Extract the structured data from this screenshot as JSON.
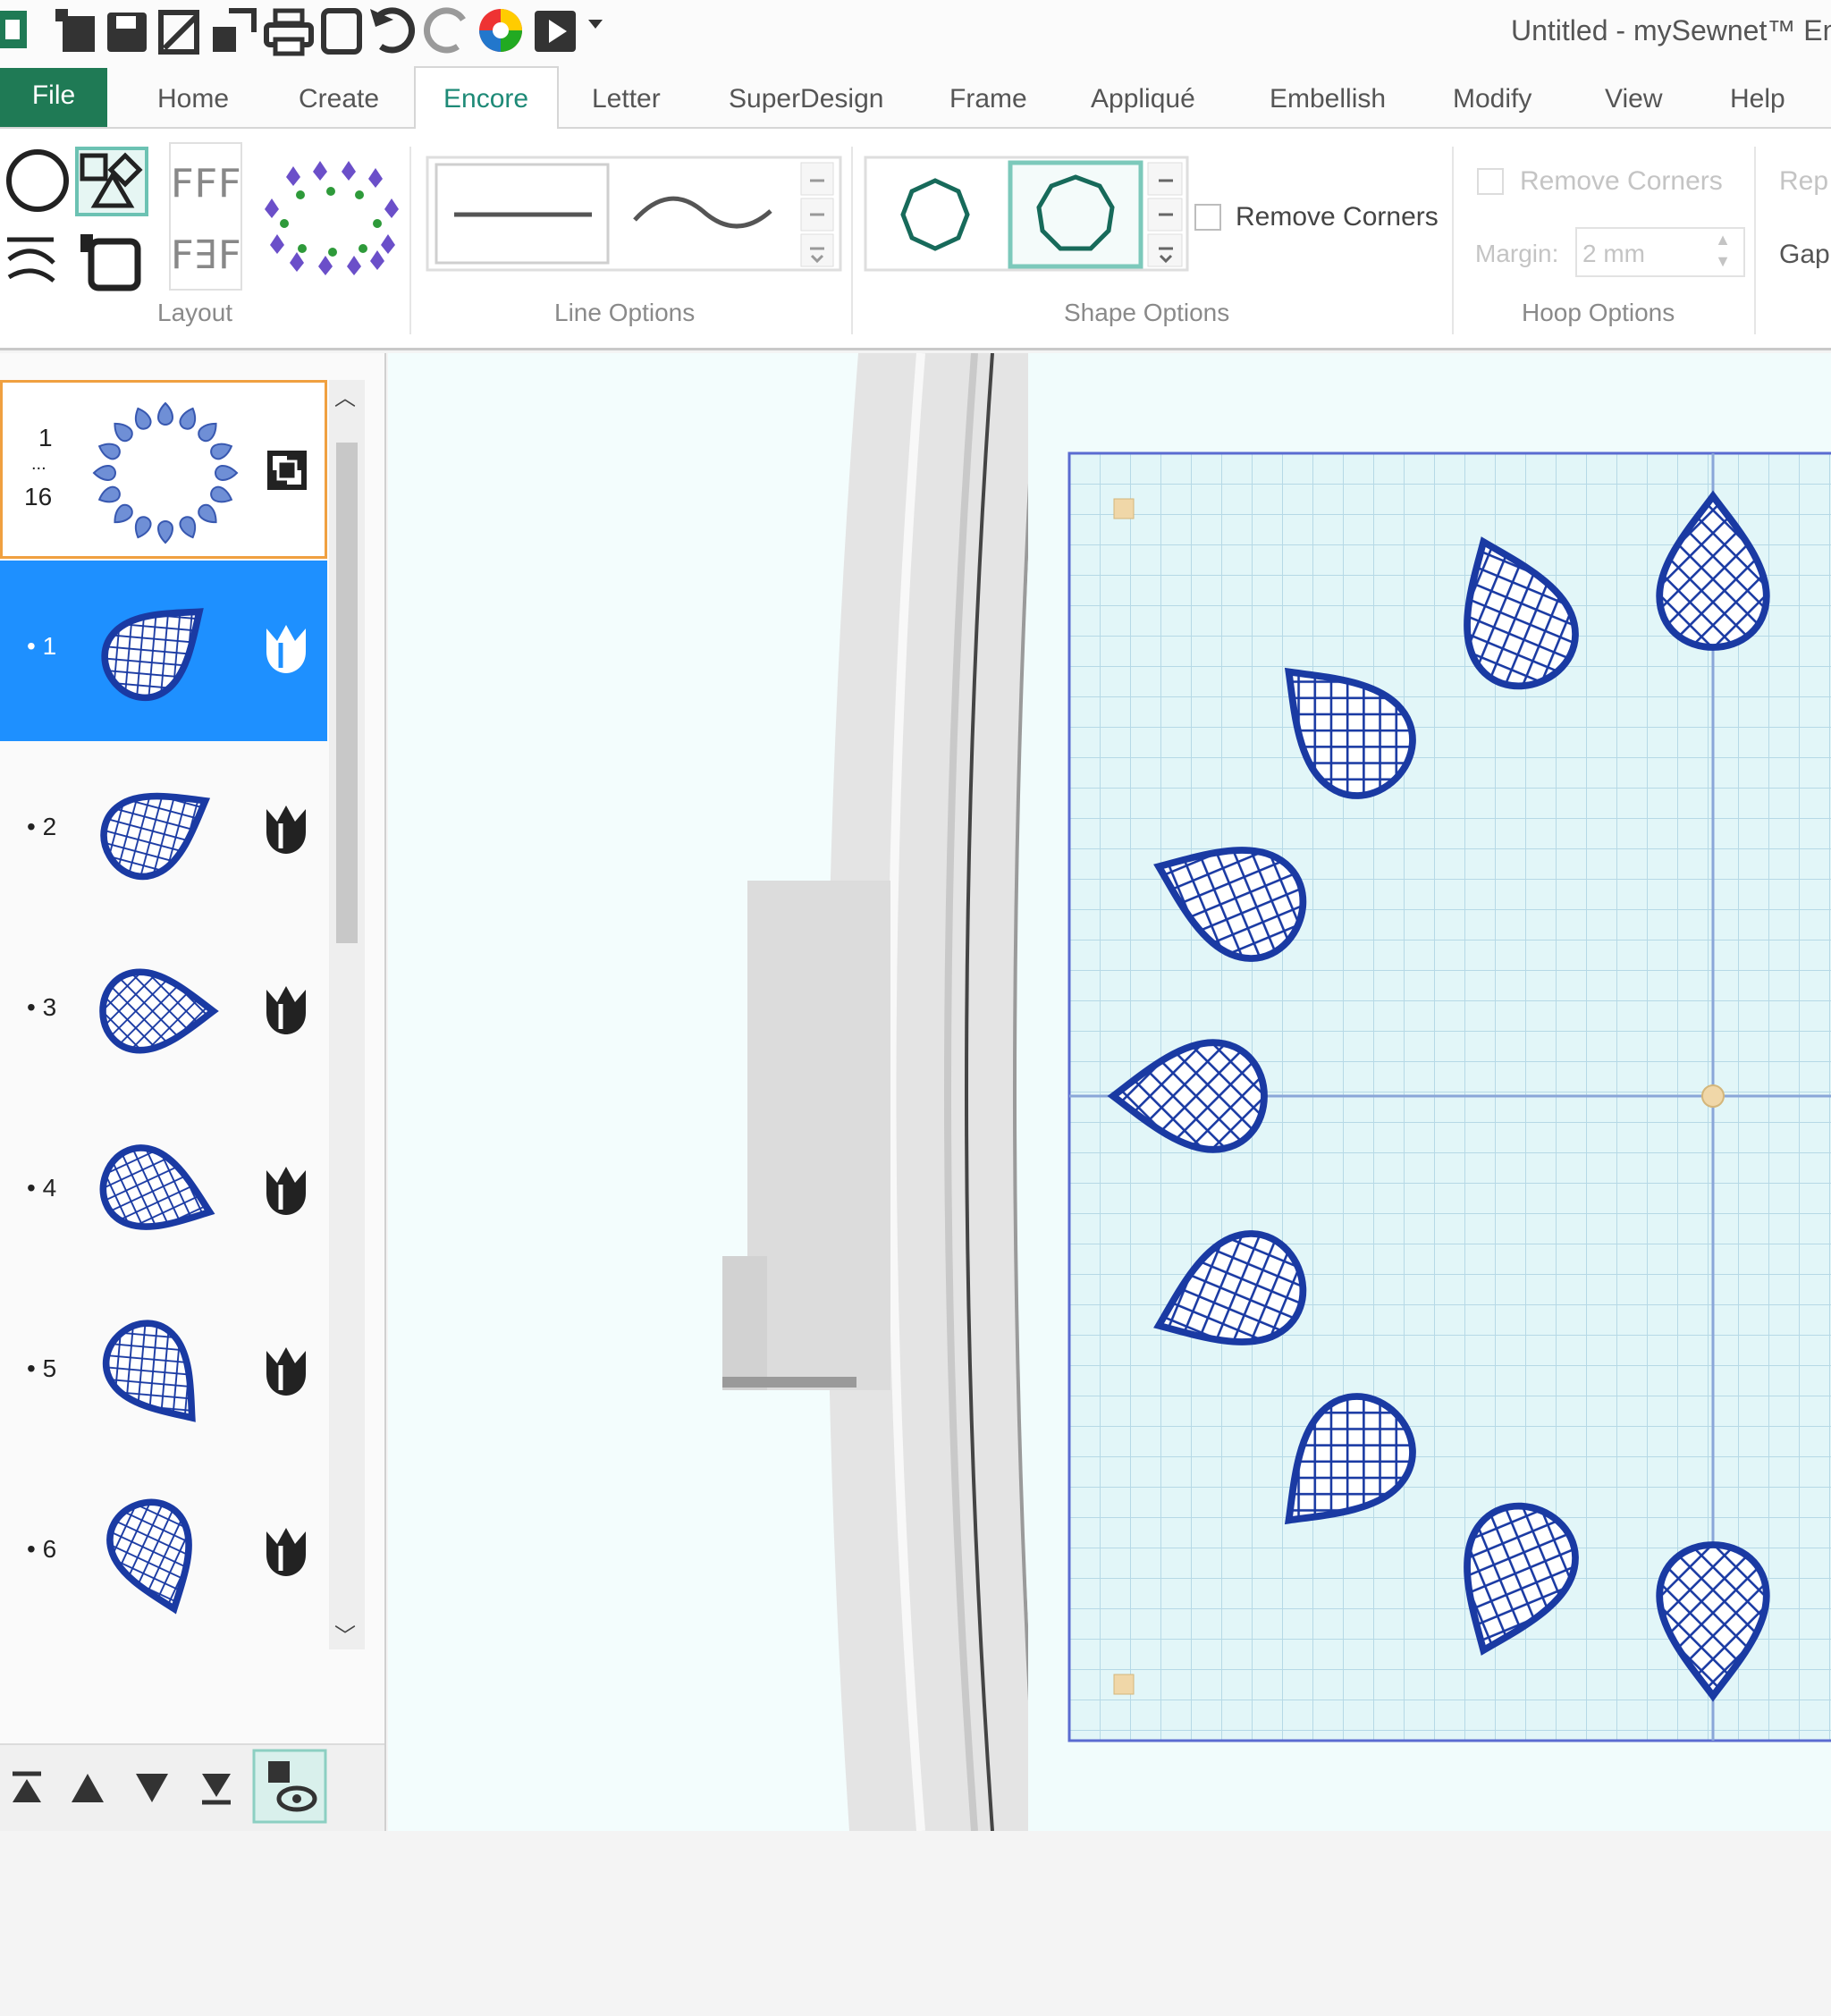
{
  "window": {
    "title": "Untitled -  mySewnet™ Em"
  },
  "tabs": {
    "file": "File",
    "home": "Home",
    "create": "Create",
    "encore": "Encore",
    "letter": "Letter",
    "superdesign": "SuperDesign",
    "frame": "Frame",
    "applique": "Appliqué",
    "embellish": "Embellish",
    "modify": "Modify",
    "view": "View",
    "help": "Help"
  },
  "ribbon": {
    "layout_label": "Layout",
    "line_options_label": "Line Options",
    "shape_options": {
      "label": "Shape Options",
      "remove_corners": "Remove Corners"
    },
    "hoop_options": {
      "label": "Hoop Options",
      "remove_corners": "Remove Corners",
      "margin_label": "Margin:",
      "margin_value": "2 mm",
      "repeat_label": "Rep",
      "gap_label": "Gap"
    }
  },
  "layers": {
    "group_range": {
      "start": "1",
      "dots": "...",
      "end": "16"
    },
    "items": [
      {
        "label": "• 1",
        "selected": true
      },
      {
        "label": "• 2"
      },
      {
        "label": "• 3"
      },
      {
        "label": "• 4"
      },
      {
        "label": "• 5"
      },
      {
        "label": "• 6"
      }
    ]
  },
  "colors": {
    "accent_green": "#1f7a55",
    "tab_active": "#1e8a77",
    "selection_blue": "#1e90ff",
    "stitch_blue": "#1a3aa3",
    "hoop_grid": "#b6d9e6"
  },
  "icons": {
    "toolbar": [
      "app-icon",
      "new-icon",
      "save-icon",
      "save-as-icon",
      "export-icon",
      "print-icon",
      "frame-icon",
      "undo-icon",
      "redo-icon",
      "color-wheel-icon",
      "play-icon",
      "dropdown-icon"
    ],
    "layer_nav": [
      "move-to-top-icon",
      "move-up-icon",
      "move-down-icon",
      "move-to-bottom-icon",
      "show-hide-icon"
    ]
  }
}
